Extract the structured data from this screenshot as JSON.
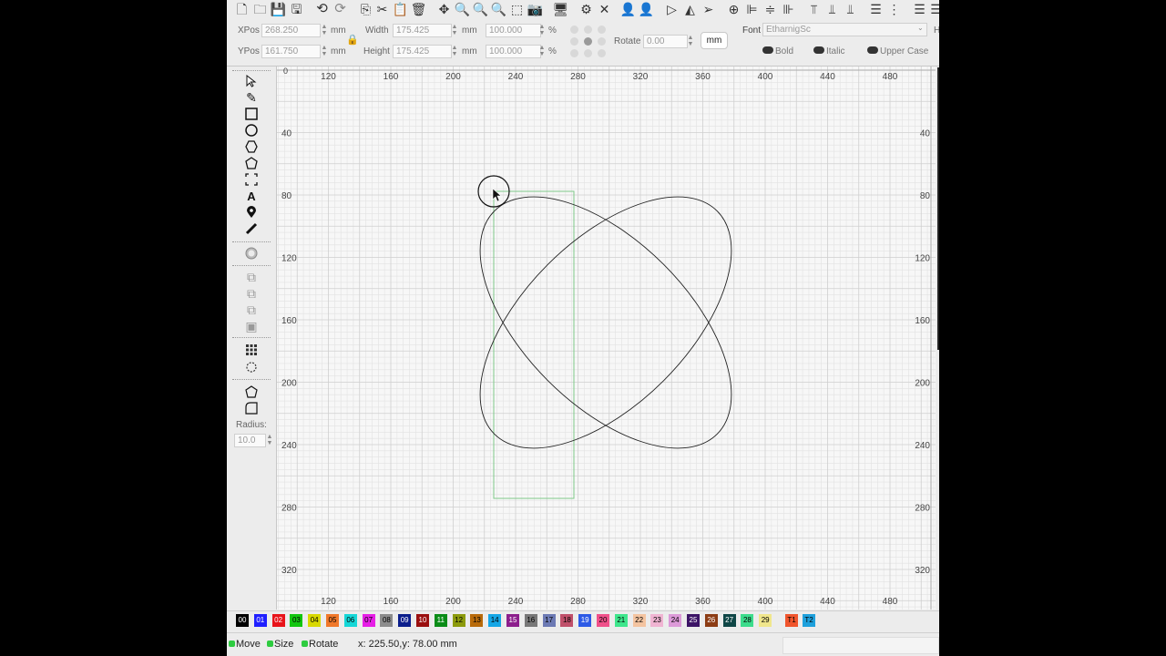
{
  "toolbar": {
    "icons": [
      "new-file-icon",
      "open-folder-icon",
      "save-icon",
      "save-as-icon",
      "export-icon",
      "undo-icon",
      "redo-icon",
      "copy-icon",
      "cut-icon",
      "paste-icon",
      "delete-icon",
      "move-icon",
      "zoom-in-icon",
      "zoom-out-icon",
      "zoom-fit-icon",
      "select-area-icon",
      "camera-icon",
      "monitor-icon",
      "settings-gear-icon",
      "tools-icon",
      "user-icon",
      "user-filled-icon",
      "play-icon",
      "mirror-icon",
      "send-icon",
      "target-icon",
      "align-left-icon",
      "align-center-icon",
      "align-right-icon",
      "align-top-icon",
      "align-middle-icon",
      "align-bottom-icon",
      "distribute-h-icon",
      "distribute-v-icon",
      "spacing-h-icon",
      "spacing-v-icon"
    ]
  },
  "props": {
    "xpos_label": "XPos",
    "xpos_value": "268.250",
    "ypos_label": "YPos",
    "ypos_value": "161.750",
    "unit_mm": "mm",
    "width_label": "Width",
    "width_value": "175.425",
    "height_label": "Height",
    "height_value": "175.425",
    "scale_w": "100.000",
    "scale_h": "100.000",
    "percent": "%",
    "rotate_label": "Rotate",
    "rotate_value": "0.00",
    "mm_button": "mm",
    "font_label": "Font",
    "font_value": "EtharnigSc",
    "bold_label": "Bold",
    "italic_label": "Italic",
    "upper_label": "Upper Case",
    "h_cut": "H"
  },
  "toolbox": {
    "radius_label": "Radius:",
    "radius_value": "10.0"
  },
  "ruler": {
    "x_labels": [
      "120",
      "160",
      "200",
      "240",
      "280",
      "320",
      "360",
      "400",
      "440",
      "480"
    ],
    "y_labels": [
      "40",
      "80",
      "120",
      "160",
      "200",
      "240",
      "280",
      "320"
    ],
    "origin": "0"
  },
  "palette": {
    "swatches": [
      {
        "label": "00",
        "color": "#000000",
        "text": "#ffffff"
      },
      {
        "label": "01",
        "color": "#1f1fff",
        "text": "#ffffff"
      },
      {
        "label": "02",
        "color": "#e8131a",
        "text": "#ffffff"
      },
      {
        "label": "03",
        "color": "#12c60f",
        "text": "#000000"
      },
      {
        "label": "04",
        "color": "#d8d800",
        "text": "#000000"
      },
      {
        "label": "05",
        "color": "#f0782a",
        "text": "#000000"
      },
      {
        "label": "06",
        "color": "#15d7d7",
        "text": "#000000"
      },
      {
        "label": "07",
        "color": "#e61ee6",
        "text": "#000000"
      },
      {
        "label": "08",
        "color": "#8c8c8c",
        "text": "#000000"
      },
      {
        "label": "09",
        "color": "#0b1e8c",
        "text": "#ffffff"
      },
      {
        "label": "10",
        "color": "#9a0f0f",
        "text": "#ffffff"
      },
      {
        "label": "11",
        "color": "#0a8c17",
        "text": "#ffffff"
      },
      {
        "label": "12",
        "color": "#8c9a0c",
        "text": "#000000"
      },
      {
        "label": "13",
        "color": "#b86a0a",
        "text": "#000000"
      },
      {
        "label": "14",
        "color": "#14a6e6",
        "text": "#000000"
      },
      {
        "label": "15",
        "color": "#8c1e8c",
        "text": "#ffffff"
      },
      {
        "label": "16",
        "color": "#787878",
        "text": "#000000"
      },
      {
        "label": "17",
        "color": "#6c7ab4",
        "text": "#000000"
      },
      {
        "label": "18",
        "color": "#c0506a",
        "text": "#000000"
      },
      {
        "label": "19",
        "color": "#2d5ae6",
        "text": "#ffffff"
      },
      {
        "label": "20",
        "color": "#f0508a",
        "text": "#000000"
      },
      {
        "label": "21",
        "color": "#3ee68c",
        "text": "#000000"
      },
      {
        "label": "22",
        "color": "#f4c4a0",
        "text": "#000000"
      },
      {
        "label": "23",
        "color": "#f0b4d2",
        "text": "#000000"
      },
      {
        "label": "24",
        "color": "#dc9ad8",
        "text": "#000000"
      },
      {
        "label": "25",
        "color": "#3c1466",
        "text": "#ffffff"
      },
      {
        "label": "26",
        "color": "#8c3c14",
        "text": "#ffffff"
      },
      {
        "label": "27",
        "color": "#0f4646",
        "text": "#ffffff"
      },
      {
        "label": "28",
        "color": "#3cdc8c",
        "text": "#000000"
      },
      {
        "label": "29",
        "color": "#f0e68c",
        "text": "#000000"
      },
      {
        "label": "T1",
        "color": "#f0552d",
        "text": "#000000"
      },
      {
        "label": "T2",
        "color": "#1ea0dc",
        "text": "#000000"
      }
    ]
  },
  "status": {
    "move": "Move",
    "size": "Size",
    "rotate": "Rotate",
    "coords": "x: 225.50,y: 78.00 mm"
  }
}
